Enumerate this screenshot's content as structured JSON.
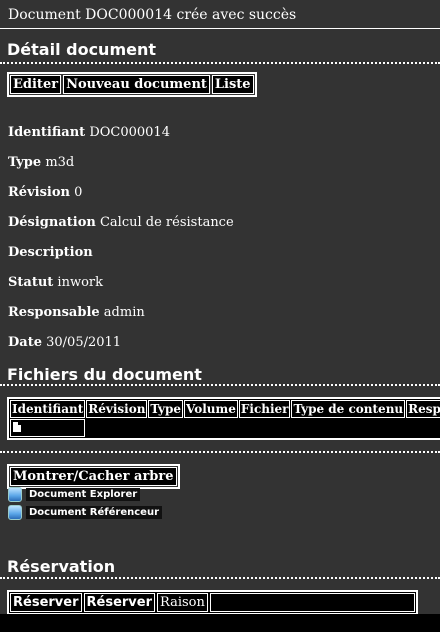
{
  "message": "Document DOC000014 crée avec succès",
  "detail": {
    "title": "Détail document",
    "buttons": [
      "Editer",
      "Nouveau document",
      "Liste"
    ],
    "fields": [
      {
        "label": "Identifiant",
        "value": "DOC000014"
      },
      {
        "label": "Type",
        "value": "m3d"
      },
      {
        "label": "Révision",
        "value": "0"
      },
      {
        "label": "Désignation",
        "value": "Calcul de résistance"
      },
      {
        "label": "Description",
        "value": ""
      },
      {
        "label": "Statut",
        "value": "inwork"
      },
      {
        "label": "Responsable",
        "value": "admin"
      },
      {
        "label": "Date",
        "value": "30/05/2011"
      }
    ]
  },
  "files": {
    "title": "Fichiers du document",
    "columns": [
      "Identifiant",
      "Révision",
      "Type",
      "Volume",
      "Fichier",
      "Type de contenu",
      "Responsable"
    ],
    "row_icon": "file-icon"
  },
  "tree": {
    "toggle_label": "Montrer/Cacher arbre",
    "items": [
      {
        "label": "Document Explorer",
        "icon": "explorer-icon"
      },
      {
        "label": "Document Référenceur",
        "icon": "referencer-icon"
      }
    ]
  },
  "reservation": {
    "title": "Réservation",
    "btn1": "Réserver",
    "btn2": "Réserver",
    "reason_label": "Raison",
    "reason_value": ""
  }
}
